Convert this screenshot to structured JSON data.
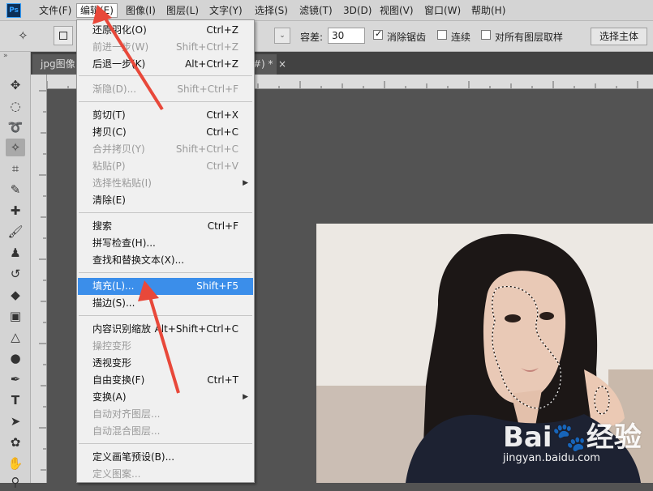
{
  "app": {
    "logo_text": "Ps"
  },
  "menubar": {
    "items": [
      "文件(F)",
      "编辑(E)",
      "图像(I)",
      "图层(L)",
      "文字(Y)",
      "选择(S)",
      "滤镜(T)",
      "3D(D)",
      "视图(V)",
      "窗口(W)",
      "帮助(H)"
    ],
    "active_index": 1
  },
  "options": {
    "tolerance_label": "容差:",
    "tolerance_value": "30",
    "antialias_label": "消除锯齿",
    "antialias_checked": true,
    "contiguous_label": "连续",
    "contiguous_checked": false,
    "sample_all_label": "对所有图层取样",
    "sample_all_checked": false,
    "select_subject_label": "选择主体"
  },
  "tabs": {
    "left_tab_label": "jpg图像",
    "right_tab_label": "#) *",
    "close_glyph": "×"
  },
  "edit_menu": {
    "items": [
      {
        "label": "还原羽化(O)",
        "shortcut": "Ctrl+Z",
        "disabled": false
      },
      {
        "label": "前进一步(W)",
        "shortcut": "Shift+Ctrl+Z",
        "disabled": true
      },
      {
        "label": "后退一步(K)",
        "shortcut": "Alt+Ctrl+Z",
        "disabled": false
      },
      {
        "label": "渐隐(D)...",
        "shortcut": "Shift+Ctrl+F",
        "disabled": true
      },
      {
        "label": "剪切(T)",
        "shortcut": "Ctrl+X",
        "disabled": false
      },
      {
        "label": "拷贝(C)",
        "shortcut": "Ctrl+C",
        "disabled": false
      },
      {
        "label": "合并拷贝(Y)",
        "shortcut": "Shift+Ctrl+C",
        "disabled": true
      },
      {
        "label": "粘贴(P)",
        "shortcut": "Ctrl+V",
        "disabled": true
      },
      {
        "label": "选择性粘贴(I)",
        "shortcut": "",
        "disabled": true,
        "submenu": true
      },
      {
        "label": "清除(E)",
        "shortcut": "",
        "disabled": false
      },
      {
        "label": "搜索",
        "shortcut": "Ctrl+F",
        "disabled": false
      },
      {
        "label": "拼写检查(H)...",
        "shortcut": "",
        "disabled": false
      },
      {
        "label": "查找和替换文本(X)...",
        "shortcut": "",
        "disabled": false
      },
      {
        "label": "填充(L)...",
        "shortcut": "Shift+F5",
        "disabled": false,
        "highlighted": true
      },
      {
        "label": "描边(S)...",
        "shortcut": "",
        "disabled": false
      },
      {
        "label": "内容识别缩放",
        "shortcut": "Alt+Shift+Ctrl+C",
        "disabled": false
      },
      {
        "label": "操控变形",
        "shortcut": "",
        "disabled": true
      },
      {
        "label": "透视变形",
        "shortcut": "",
        "disabled": false
      },
      {
        "label": "自由变换(F)",
        "shortcut": "Ctrl+T",
        "disabled": false
      },
      {
        "label": "变换(A)",
        "shortcut": "",
        "disabled": false,
        "submenu": true
      },
      {
        "label": "自动对齐图层...",
        "shortcut": "",
        "disabled": true
      },
      {
        "label": "自动混合图层...",
        "shortcut": "",
        "disabled": true
      },
      {
        "label": "定义画笔预设(B)...",
        "shortcut": "",
        "disabled": false
      },
      {
        "label": "定义图案...",
        "shortcut": "",
        "disabled": true
      }
    ]
  },
  "watermark": {
    "logo": "Bai🐾经验",
    "url": "jingyan.baidu.com"
  },
  "colors": {
    "highlight": "#3b8eea",
    "arrow": "#e8483a"
  }
}
